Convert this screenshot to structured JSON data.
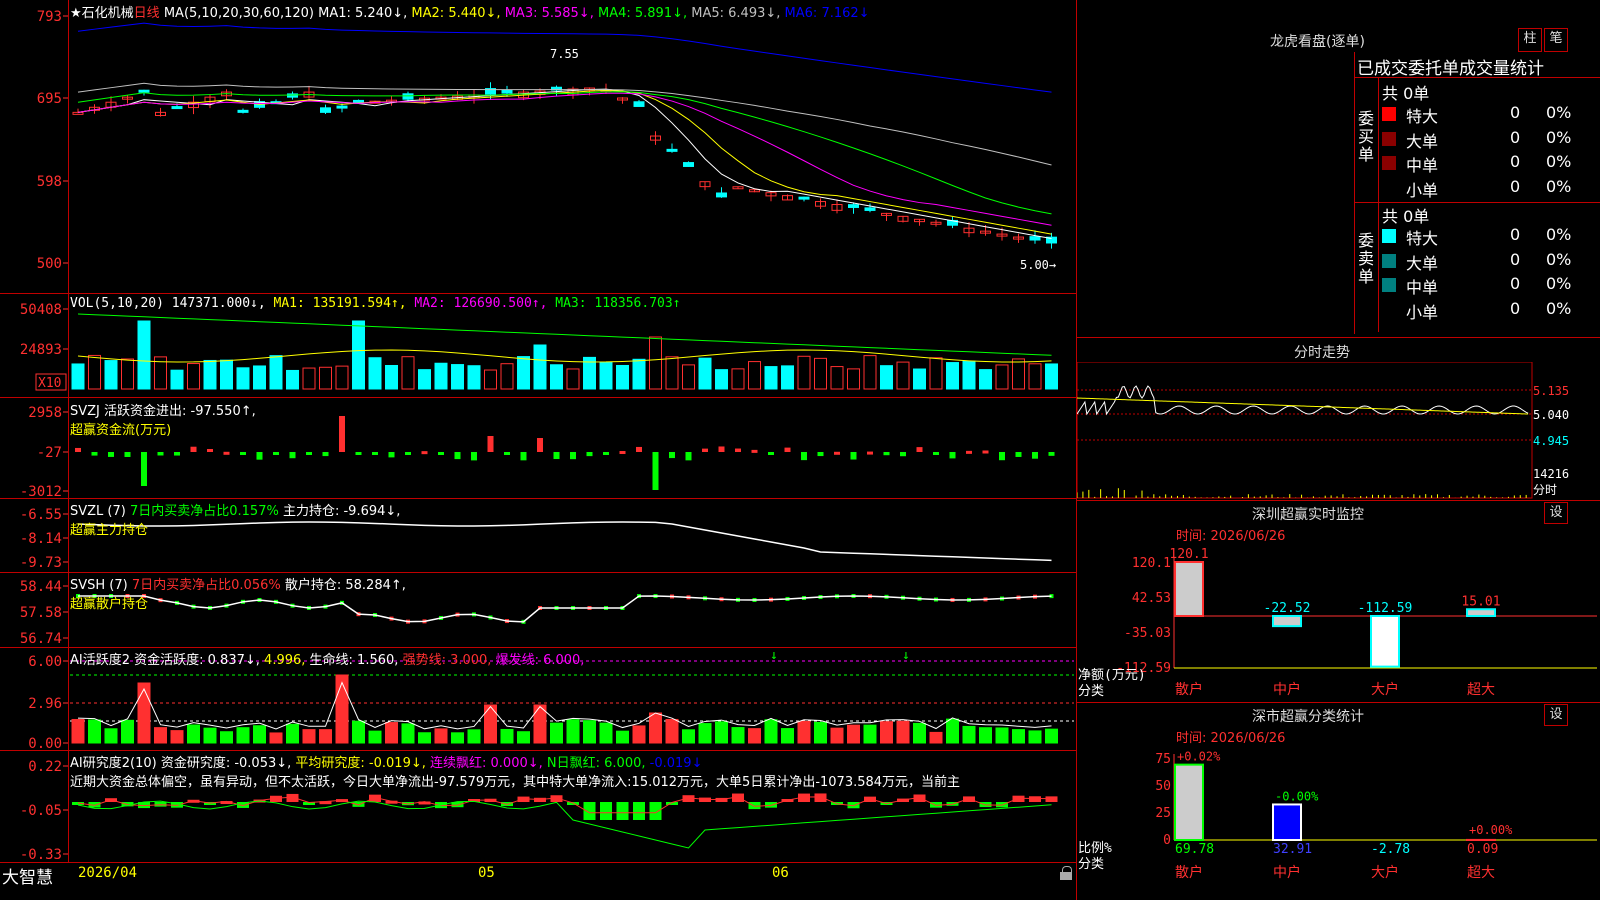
{
  "colors": {
    "up": "#ff3030",
    "down": "#00ffff",
    "grid": "#c00000",
    "ma1": "#ffffff",
    "ma2": "#ffff00",
    "ma3": "#ff00ff",
    "ma4": "#00ff00",
    "ma5": "#c0c0c0",
    "ma6": "#0000ff",
    "green": "#00ff00",
    "yellow": "#ffff00"
  },
  "main": {
    "star": "★",
    "stock_name": "石化机械",
    "period": "日线",
    "ma_title": "MA(5,10,20,30,60,120)",
    "ma1": "MA1: 5.240↓,",
    "ma2": "MA2: 5.440↓,",
    "ma3": "MA3: 5.585↓,",
    "ma4": "MA4: 5.891↓,",
    "ma5": "MA5: 6.493↓,",
    "ma6": "MA6: 7.162↓",
    "y_ticks": [
      "793",
      "695",
      "598",
      "500"
    ],
    "high_label": "7.55",
    "low_label": "5.00→"
  },
  "vol": {
    "title": "VOL(5,10,20)",
    "value": "147371.000↓,",
    "ma1": "MA1: 135191.594↑,",
    "ma2": "MA2: 126690.500↑,",
    "ma3": "MA3: 118356.703↑",
    "y_ticks": [
      "50408",
      "24893"
    ],
    "unit": "X10"
  },
  "svzj": {
    "title": "SVZJ",
    "label": "活跃资金进出: -97.550↑,",
    "sub": "超赢资金流(万元)",
    "y_ticks": [
      "2958",
      "-27",
      "-3012"
    ]
  },
  "svzl": {
    "title": "SVZL (7)",
    "ratio": "7日内买卖净占比0.157%",
    "hold": "主力持仓: -9.694↓,",
    "sub": "超赢主力持仓",
    "y_ticks": [
      "-6.55",
      "-8.14",
      "-9.73"
    ]
  },
  "svsh": {
    "title": "SVSH (7)",
    "ratio": "7日内买卖净占比0.056%",
    "hold": "散户持仓: 58.284↑,",
    "sub": "超赢散户持仓",
    "y_ticks": [
      "58.44",
      "57.58",
      "56.74"
    ]
  },
  "ai1": {
    "title": "AI活跃度2",
    "act": "资金活跃度: 0.837↓,",
    "val2": "4.996,",
    "life": "生命线: 1.560,",
    "strong": "强势线: 3.000,",
    "burst": "爆发线: 6.000,",
    "y_ticks": [
      "6.00",
      "2.96",
      "0.00"
    ]
  },
  "ai2": {
    "title": "AI研究度2(10)",
    "res": "资金研究度: -0.053↓,",
    "avg": "平均研究度: -0.019↓,",
    "red": "连续飘红: 0.000↓,",
    "nred": "N日飘红: 6.000,",
    "neg": "-0.019↓",
    "comment": "近期大资金总体偏空，虽有异动，但不太活跃，今日大单净流出-97.579万元，其中特大单净流入:15.012万元，大单5日累计净出-1073.584万元，当前主",
    "y_ticks": [
      "0.22",
      "-0.05",
      "-0.33"
    ]
  },
  "footer": {
    "brand": "大智慧",
    "dates": [
      "2026/04",
      "05",
      "06"
    ]
  },
  "right": {
    "lhb_title": "龙虎看盘(逐单)",
    "btn_zhu": "柱",
    "btn_bi": "笔",
    "tabs_text": "已成交委托单成交量统计",
    "buy_label": "委买单",
    "sell_label": "委卖单",
    "buy_total": "共 0单",
    "sell_total": "共 0单",
    "buy_rows": [
      {
        "name": "特大",
        "qty": "0",
        "pct": "0%"
      },
      {
        "name": "大单",
        "qty": "0",
        "pct": "0%"
      },
      {
        "name": "中单",
        "qty": "0",
        "pct": "0%"
      },
      {
        "name": "小单",
        "qty": "0",
        "pct": "0%"
      }
    ],
    "sell_rows": [
      {
        "name": "特大",
        "qty": "0",
        "pct": "0%"
      },
      {
        "name": "大单",
        "qty": "0",
        "pct": "0%"
      },
      {
        "name": "中单",
        "qty": "0",
        "pct": "0%"
      },
      {
        "name": "小单",
        "qty": "0",
        "pct": "0%"
      }
    ],
    "intraday_title": "分时走势",
    "intraday_ticks": [
      "5.135",
      "5.040",
      "4.945"
    ],
    "intraday_vol": "14216",
    "intraday_vol_lbl": "分时",
    "sz_monitor_title": "深圳超赢实时监控",
    "set_btn": "设",
    "time1": "时间: 2026/06/26",
    "monitor_ticks": [
      "120.1",
      "42.53",
      "-35.03",
      "-112.59"
    ],
    "monitor_vals": [
      "120.1",
      "-22.52",
      "-112.59",
      "15.01"
    ],
    "monitor_cats": [
      "散户",
      "中户",
      "大户",
      "超大"
    ],
    "net_label": "净额(万元)",
    "cat_label": "分类",
    "sz_stat_title": "深市超赢分类统计",
    "time2": "时间: 2026/06/26",
    "stat_ticks": [
      "75",
      "50",
      "25",
      "0"
    ],
    "stat_top": [
      "+0.02%",
      "-0.00%",
      "",
      "+0.00%"
    ],
    "stat_vals": [
      "69.78",
      "32.91",
      "-2.78",
      "0.09"
    ],
    "ratio_label": "比例%",
    "cat_label2": "分类"
  }
}
